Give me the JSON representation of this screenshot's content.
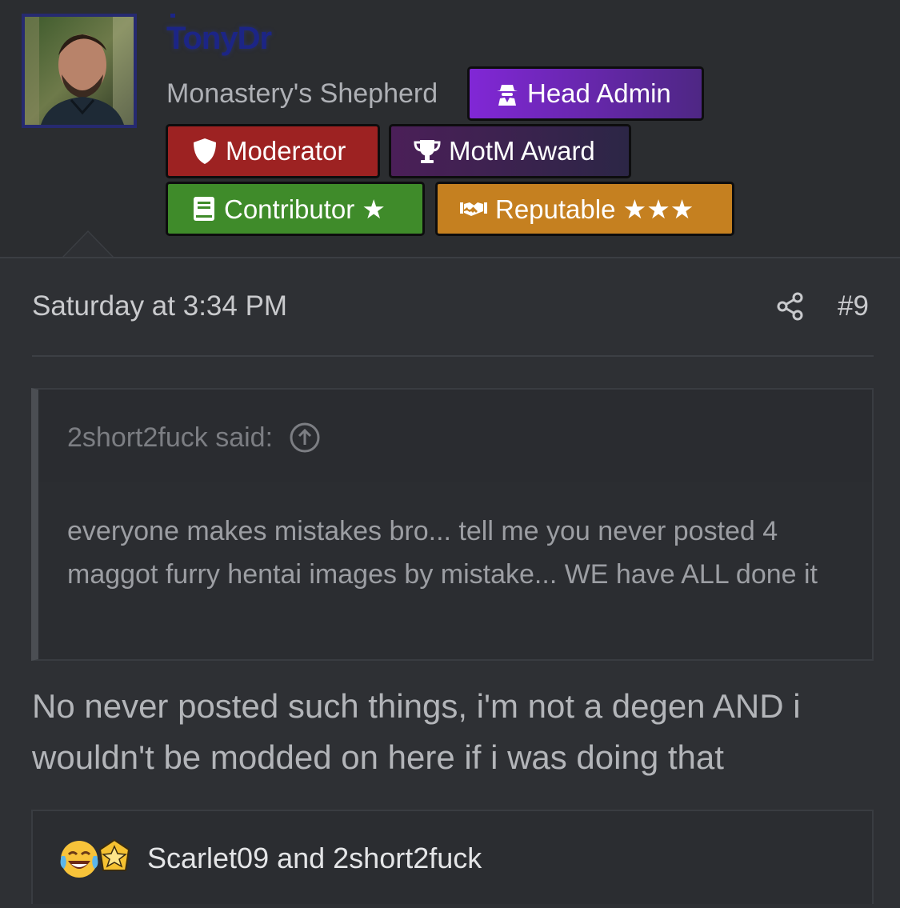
{
  "user": {
    "username": "TonyDr",
    "title": "Monastery's Shepherd",
    "avatar_alt": "avatar"
  },
  "badges": {
    "head_admin": {
      "label": "Head Admin",
      "color": "#7a2bd0"
    },
    "moderator": {
      "label": "Moderator",
      "color": "#9d2222"
    },
    "motm": {
      "label": "MotM Award",
      "color": "#3f2350"
    },
    "contributor": {
      "label": "Contributor ★",
      "color": "#3f8b2a"
    },
    "reputable": {
      "label": "Reputable ★★★",
      "color": "#c58020"
    }
  },
  "post": {
    "timestamp": "Saturday at 3:34 PM",
    "number": "#9",
    "quote": {
      "author": "2short2fuck said:",
      "text": "everyone makes mistakes bro... tell me you never posted 4 maggot furry hentai images by mistake... WE have ALL done it"
    },
    "message": "No never posted such things, i'm not a degen AND i wouldn't be modded on here if i was doing that",
    "reactions": {
      "icons": [
        "laughing-crying-emoji-icon",
        "star-badge-icon"
      ],
      "text": "Scarlet09 and 2short2fuck"
    }
  }
}
